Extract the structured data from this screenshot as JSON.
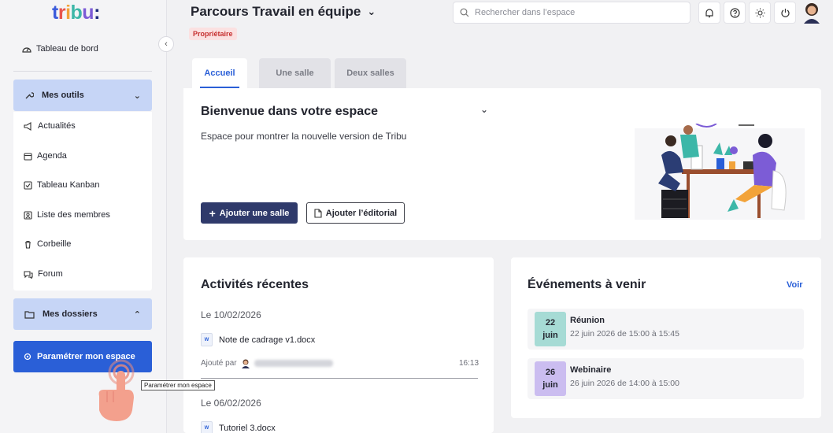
{
  "app": {
    "logo_text": "tribu:"
  },
  "sidebar": {
    "dashboard_label": "Tableau de bord",
    "tools_section": {
      "label": "Mes outils"
    },
    "tools": [
      {
        "label": "Actualités",
        "icon": "megaphone-icon"
      },
      {
        "label": "Agenda",
        "icon": "calendar-icon"
      },
      {
        "label": "Tableau Kanban",
        "icon": "kanban-icon"
      },
      {
        "label": "Liste des membres",
        "icon": "members-icon"
      },
      {
        "label": "Corbeille",
        "icon": "trash-icon"
      },
      {
        "label": "Forum",
        "icon": "forum-icon"
      }
    ],
    "folders_section": {
      "label": "Mes dossiers"
    },
    "config_button": "Paramétrer mon espace",
    "tooltip": "Paramétrer mon espace"
  },
  "header": {
    "title": "Parcours Travail en équipe",
    "role_badge": "Propriétaire",
    "search_placeholder": "Rechercher dans l’espace"
  },
  "tabs": [
    {
      "label": "Accueil",
      "active": true
    },
    {
      "label": "Une salle",
      "active": false
    },
    {
      "label": "Deux salles",
      "active": false
    }
  ],
  "welcome": {
    "title": "Bienvenue dans votre espace",
    "description": "Espace pour montrer la nouvelle version de Tribu",
    "add_room_button": "Ajouter une salle",
    "add_editorial_button": "Ajouter l’éditorial"
  },
  "activities": {
    "title": "Activités récentes",
    "groups": [
      {
        "date": "Le 10/02/2026",
        "file": "Note de cadrage v1.docx",
        "added_by_prefix": "Ajouté par",
        "time": "16:13"
      },
      {
        "date": "Le 06/02/2026",
        "file": "Tutoriel 3.docx"
      }
    ]
  },
  "events": {
    "title": "Événements à venir",
    "see_link": "Voir",
    "items": [
      {
        "day": "22",
        "month": "juin",
        "name": "Réunion",
        "when": "22 juin 2026 de 15:00 à 15:45",
        "color": "#a6dbd5"
      },
      {
        "day": "26",
        "month": "juin",
        "name": "Webinaire",
        "when": "26 juin 2026 de 14:00 à 15:00",
        "color": "#cbbdf0"
      }
    ]
  },
  "colors": {
    "primary": "#2a5fd7",
    "section_head": "#c6d5f6",
    "dark_button": "#2f3a6b",
    "badge_bg": "#fbe1e1",
    "badge_text": "#c62f2f"
  }
}
